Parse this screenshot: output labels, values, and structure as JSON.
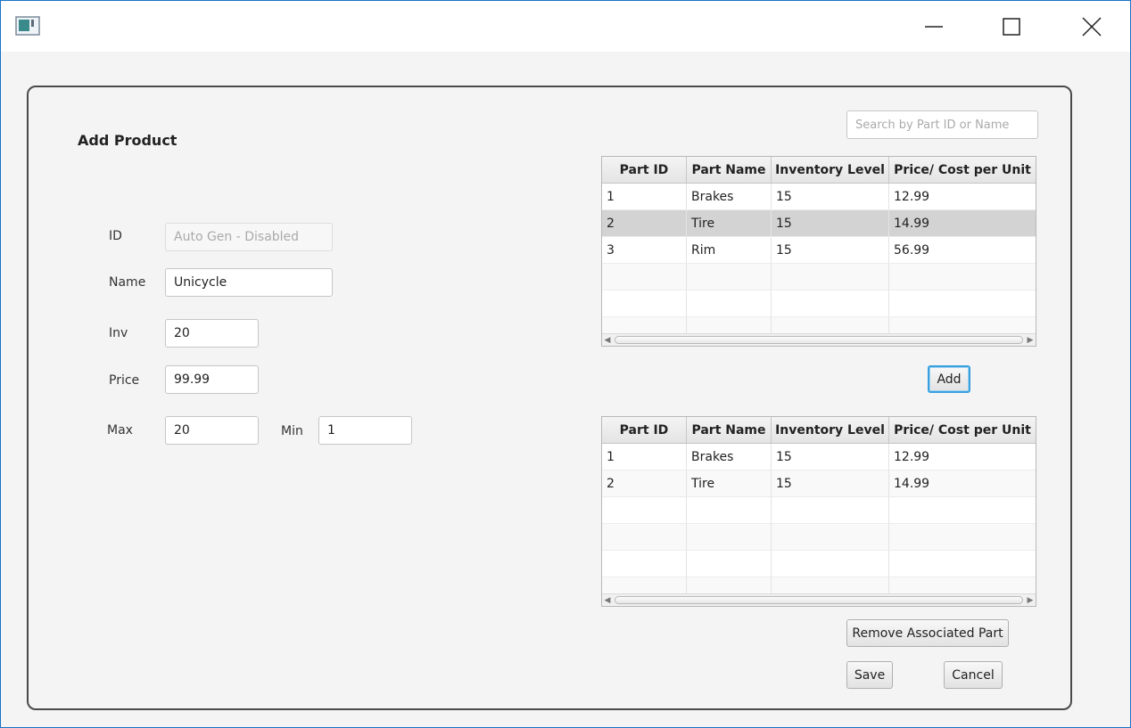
{
  "window": {
    "icon": "app-window-icon",
    "controls": {
      "minimize": "minimize-icon",
      "maximize": "maximize-icon",
      "close": "close-icon"
    }
  },
  "form": {
    "title": "Add Product",
    "id": {
      "label": "ID",
      "placeholder": "Auto Gen - Disabled"
    },
    "name": {
      "label": "Name",
      "value": "Unicycle"
    },
    "inv": {
      "label": "Inv",
      "value": "20"
    },
    "price": {
      "label": "Price",
      "value": "99.99"
    },
    "max": {
      "label": "Max",
      "value": "20"
    },
    "min": {
      "label": "Min",
      "value": "1"
    }
  },
  "search": {
    "placeholder": "Search by Part ID or Name"
  },
  "columns": [
    "Part ID",
    "Part Name",
    "Inventory Level",
    "Price/ Cost per Unit"
  ],
  "all_parts": [
    [
      "1",
      "Brakes",
      "15",
      "12.99"
    ],
    [
      "2",
      "Tire",
      "15",
      "14.99"
    ],
    [
      "3",
      "Rim",
      "15",
      "56.99"
    ]
  ],
  "associated_parts": [
    [
      "1",
      "Brakes",
      "15",
      "12.99"
    ],
    [
      "2",
      "Tire",
      "15",
      "14.99"
    ]
  ],
  "buttons": {
    "add": "Add",
    "remove": "Remove Associated Part",
    "save": "Save",
    "cancel": "Cancel"
  },
  "colors": {
    "accent": "#39a0df",
    "selected_row": "#d3d3d3",
    "window_border": "#1a73c8"
  }
}
